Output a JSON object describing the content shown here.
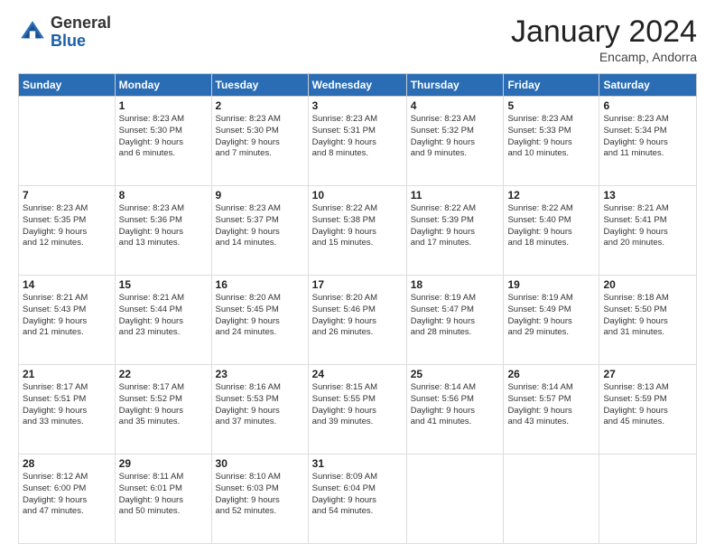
{
  "logo": {
    "general": "General",
    "blue": "Blue"
  },
  "header": {
    "month": "January 2024",
    "location": "Encamp, Andorra"
  },
  "weekdays": [
    "Sunday",
    "Monday",
    "Tuesday",
    "Wednesday",
    "Thursday",
    "Friday",
    "Saturday"
  ],
  "weeks": [
    [
      {
        "day": "",
        "info": ""
      },
      {
        "day": "1",
        "info": "Sunrise: 8:23 AM\nSunset: 5:30 PM\nDaylight: 9 hours\nand 6 minutes."
      },
      {
        "day": "2",
        "info": "Sunrise: 8:23 AM\nSunset: 5:30 PM\nDaylight: 9 hours\nand 7 minutes."
      },
      {
        "day": "3",
        "info": "Sunrise: 8:23 AM\nSunset: 5:31 PM\nDaylight: 9 hours\nand 8 minutes."
      },
      {
        "day": "4",
        "info": "Sunrise: 8:23 AM\nSunset: 5:32 PM\nDaylight: 9 hours\nand 9 minutes."
      },
      {
        "day": "5",
        "info": "Sunrise: 8:23 AM\nSunset: 5:33 PM\nDaylight: 9 hours\nand 10 minutes."
      },
      {
        "day": "6",
        "info": "Sunrise: 8:23 AM\nSunset: 5:34 PM\nDaylight: 9 hours\nand 11 minutes."
      }
    ],
    [
      {
        "day": "7",
        "info": "Sunrise: 8:23 AM\nSunset: 5:35 PM\nDaylight: 9 hours\nand 12 minutes."
      },
      {
        "day": "8",
        "info": "Sunrise: 8:23 AM\nSunset: 5:36 PM\nDaylight: 9 hours\nand 13 minutes."
      },
      {
        "day": "9",
        "info": "Sunrise: 8:23 AM\nSunset: 5:37 PM\nDaylight: 9 hours\nand 14 minutes."
      },
      {
        "day": "10",
        "info": "Sunrise: 8:22 AM\nSunset: 5:38 PM\nDaylight: 9 hours\nand 15 minutes."
      },
      {
        "day": "11",
        "info": "Sunrise: 8:22 AM\nSunset: 5:39 PM\nDaylight: 9 hours\nand 17 minutes."
      },
      {
        "day": "12",
        "info": "Sunrise: 8:22 AM\nSunset: 5:40 PM\nDaylight: 9 hours\nand 18 minutes."
      },
      {
        "day": "13",
        "info": "Sunrise: 8:21 AM\nSunset: 5:41 PM\nDaylight: 9 hours\nand 20 minutes."
      }
    ],
    [
      {
        "day": "14",
        "info": "Sunrise: 8:21 AM\nSunset: 5:43 PM\nDaylight: 9 hours\nand 21 minutes."
      },
      {
        "day": "15",
        "info": "Sunrise: 8:21 AM\nSunset: 5:44 PM\nDaylight: 9 hours\nand 23 minutes."
      },
      {
        "day": "16",
        "info": "Sunrise: 8:20 AM\nSunset: 5:45 PM\nDaylight: 9 hours\nand 24 minutes."
      },
      {
        "day": "17",
        "info": "Sunrise: 8:20 AM\nSunset: 5:46 PM\nDaylight: 9 hours\nand 26 minutes."
      },
      {
        "day": "18",
        "info": "Sunrise: 8:19 AM\nSunset: 5:47 PM\nDaylight: 9 hours\nand 28 minutes."
      },
      {
        "day": "19",
        "info": "Sunrise: 8:19 AM\nSunset: 5:49 PM\nDaylight: 9 hours\nand 29 minutes."
      },
      {
        "day": "20",
        "info": "Sunrise: 8:18 AM\nSunset: 5:50 PM\nDaylight: 9 hours\nand 31 minutes."
      }
    ],
    [
      {
        "day": "21",
        "info": "Sunrise: 8:17 AM\nSunset: 5:51 PM\nDaylight: 9 hours\nand 33 minutes."
      },
      {
        "day": "22",
        "info": "Sunrise: 8:17 AM\nSunset: 5:52 PM\nDaylight: 9 hours\nand 35 minutes."
      },
      {
        "day": "23",
        "info": "Sunrise: 8:16 AM\nSunset: 5:53 PM\nDaylight: 9 hours\nand 37 minutes."
      },
      {
        "day": "24",
        "info": "Sunrise: 8:15 AM\nSunset: 5:55 PM\nDaylight: 9 hours\nand 39 minutes."
      },
      {
        "day": "25",
        "info": "Sunrise: 8:14 AM\nSunset: 5:56 PM\nDaylight: 9 hours\nand 41 minutes."
      },
      {
        "day": "26",
        "info": "Sunrise: 8:14 AM\nSunset: 5:57 PM\nDaylight: 9 hours\nand 43 minutes."
      },
      {
        "day": "27",
        "info": "Sunrise: 8:13 AM\nSunset: 5:59 PM\nDaylight: 9 hours\nand 45 minutes."
      }
    ],
    [
      {
        "day": "28",
        "info": "Sunrise: 8:12 AM\nSunset: 6:00 PM\nDaylight: 9 hours\nand 47 minutes."
      },
      {
        "day": "29",
        "info": "Sunrise: 8:11 AM\nSunset: 6:01 PM\nDaylight: 9 hours\nand 50 minutes."
      },
      {
        "day": "30",
        "info": "Sunrise: 8:10 AM\nSunset: 6:03 PM\nDaylight: 9 hours\nand 52 minutes."
      },
      {
        "day": "31",
        "info": "Sunrise: 8:09 AM\nSunset: 6:04 PM\nDaylight: 9 hours\nand 54 minutes."
      },
      {
        "day": "",
        "info": ""
      },
      {
        "day": "",
        "info": ""
      },
      {
        "day": "",
        "info": ""
      }
    ]
  ]
}
